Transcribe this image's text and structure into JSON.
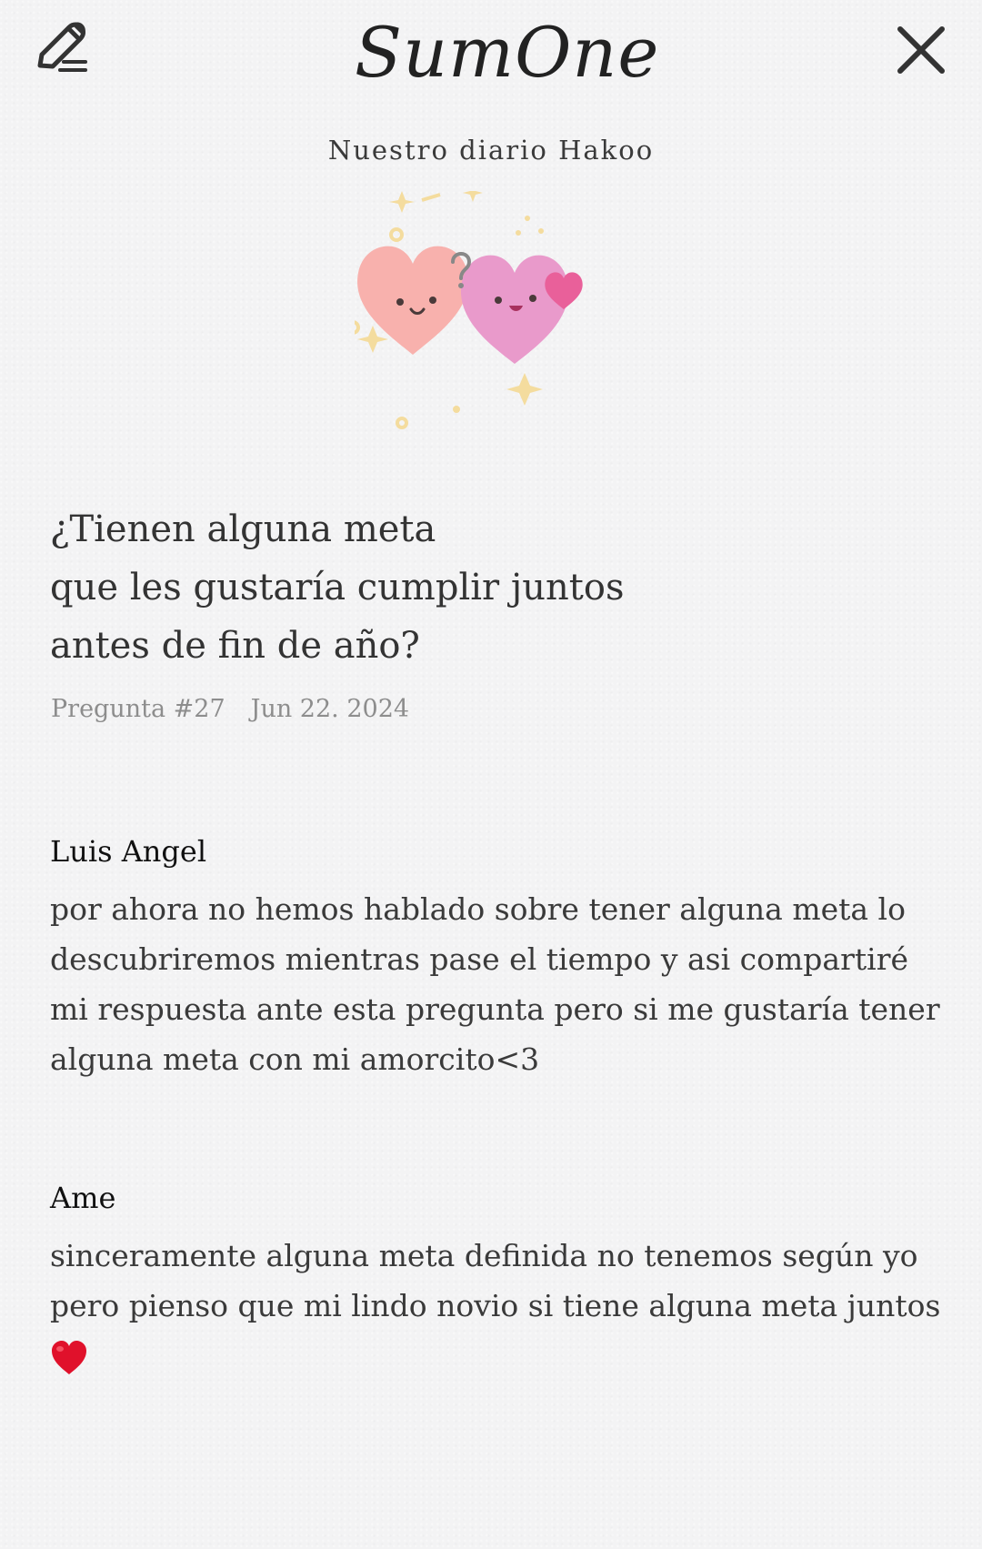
{
  "app": {
    "logo_text": "SumOne",
    "diary_title": "Nuestro diario Hakoo"
  },
  "toolbar": {
    "edit_icon": "pencil-edit-icon",
    "close_icon": "close-icon"
  },
  "question": {
    "lines": [
      "¿Tienen alguna meta",
      "que les gustaría cumplir juntos",
      "antes de fin de año?"
    ],
    "number_label": "Pregunta #27",
    "date": "Jun 22. 2024"
  },
  "answers": [
    {
      "name": "Luis Angel",
      "lines": [
        "por ahora no hemos hablado sobre tener alguna meta  lo",
        "descubriremos mientras pase el tiempo y asi compartiré",
        "mi respuesta ante esta pregunta pero si me gustaría tener",
        "alguna meta con mi amorcito<3"
      ]
    },
    {
      "name": "Ame",
      "lines": [
        "sinceramente alguna meta definida no tenemos según yo",
        "pero pienso que mi lindo novio si tiene alguna meta juntos"
      ],
      "emoji_icon": "red-heart-icon"
    }
  ],
  "colors": {
    "background": "#f3f3f4",
    "left_heart": "#f8b1ad",
    "right_heart": "#e99acb",
    "small_heart": "#e9609a",
    "sparkles": "#f4dc9e",
    "emoji_heart": "#e0112b"
  }
}
